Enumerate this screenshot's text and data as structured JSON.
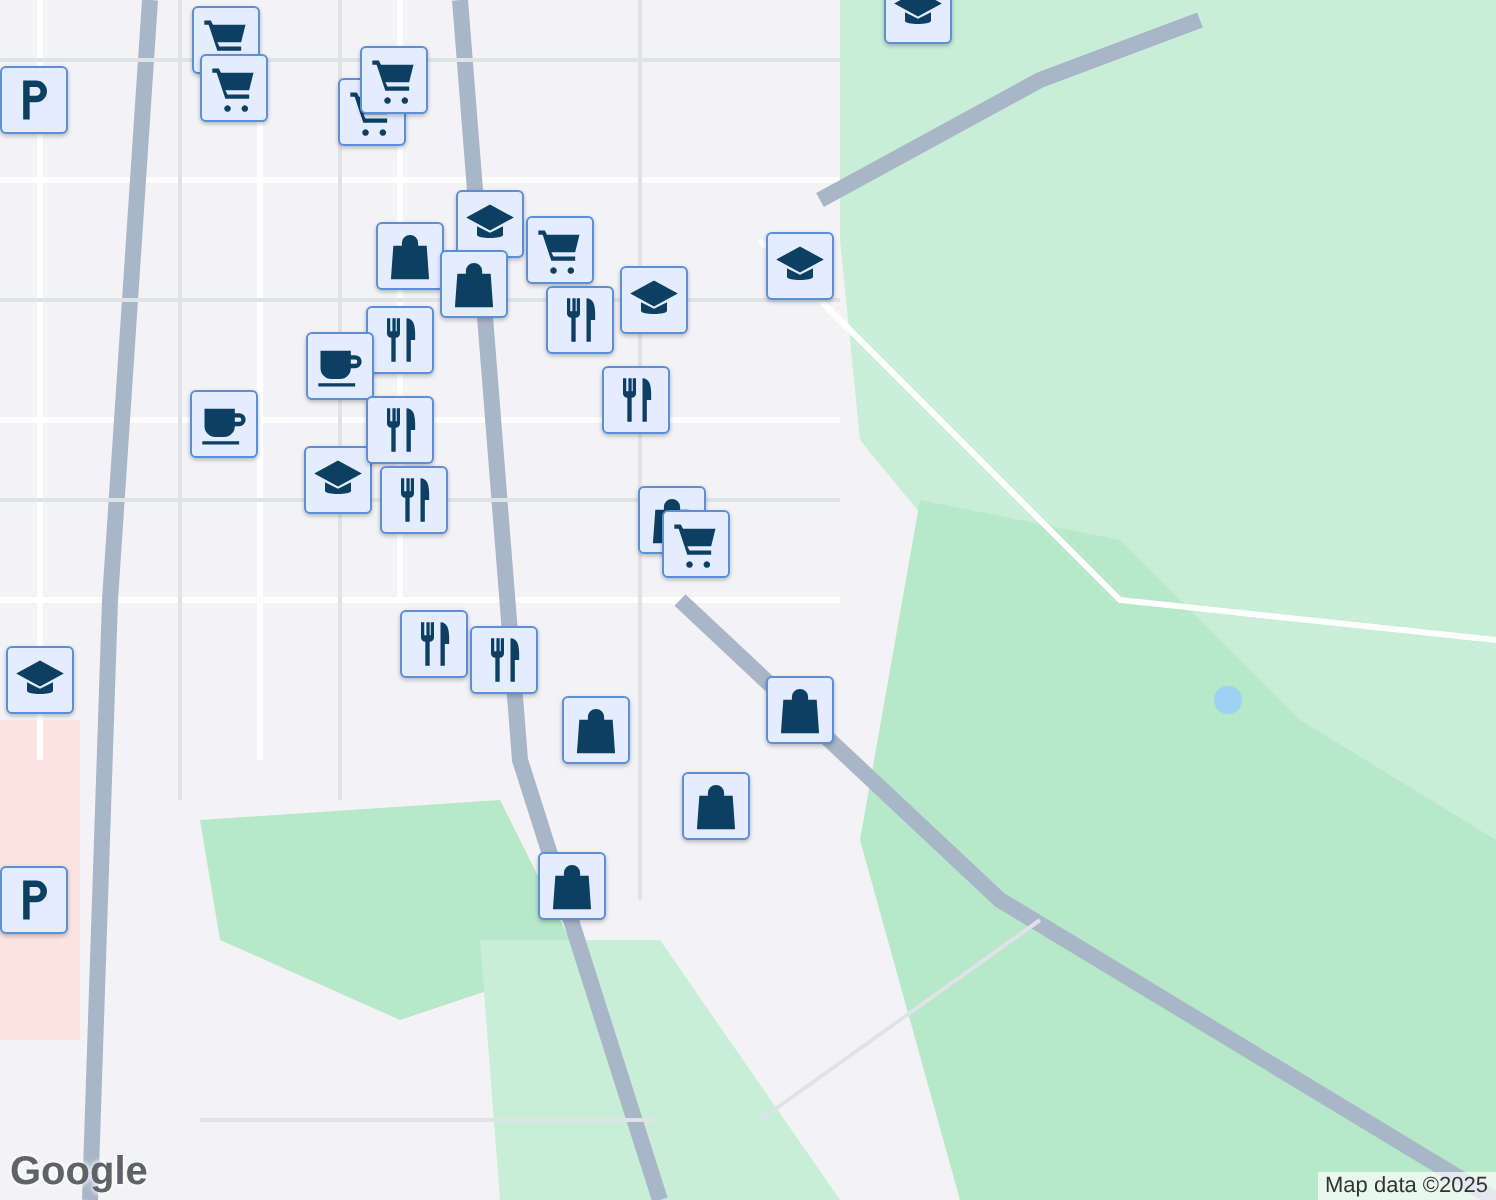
{
  "markers": [
    {
      "kind": "grocery"
    },
    {
      "kind": "grocery"
    },
    {
      "kind": "grocery"
    },
    {
      "kind": "grocery"
    },
    {
      "kind": "school"
    },
    {
      "kind": "parking"
    },
    {
      "kind": "school"
    },
    {
      "kind": "shopping"
    },
    {
      "kind": "shopping"
    },
    {
      "kind": "grocery"
    },
    {
      "kind": "restaurant"
    },
    {
      "kind": "school"
    },
    {
      "kind": "school"
    },
    {
      "kind": "restaurant"
    },
    {
      "kind": "cafe"
    },
    {
      "kind": "cafe"
    },
    {
      "kind": "restaurant"
    },
    {
      "kind": "school"
    },
    {
      "kind": "restaurant"
    },
    {
      "kind": "restaurant"
    },
    {
      "kind": "shopping"
    },
    {
      "kind": "grocery"
    },
    {
      "kind": "school"
    },
    {
      "kind": "restaurant"
    },
    {
      "kind": "restaurant"
    },
    {
      "kind": "shopping"
    },
    {
      "kind": "shopping"
    },
    {
      "kind": "shopping"
    },
    {
      "kind": "shopping"
    },
    {
      "kind": "parking"
    }
  ],
  "logo": "Google",
  "attribution": "Map data ©2025"
}
